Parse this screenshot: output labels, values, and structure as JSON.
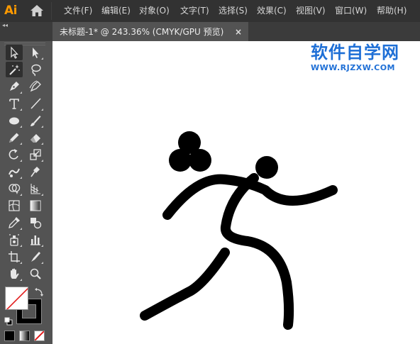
{
  "app": {
    "logo": "Ai"
  },
  "menu": {
    "items": [
      "文件(F)",
      "编辑(E)",
      "对象(O)",
      "文字(T)",
      "选择(S)",
      "效果(C)",
      "视图(V)",
      "窗口(W)",
      "帮助(H)"
    ]
  },
  "panel": {
    "collapse_glyph": "◂◂"
  },
  "document_tab": {
    "label": "未标题-1* @ 243.36% (CMYK/GPU 预览)",
    "close_glyph": "×"
  },
  "toolbar": {
    "tools": [
      "selection-tool",
      "direct-selection-tool",
      "magic-wand-tool",
      "lasso-tool",
      "pen-tool",
      "curvature-tool",
      "type-tool",
      "line-segment-tool",
      "ellipse-tool",
      "paintbrush-tool",
      "pencil-tool",
      "eraser-tool",
      "rotate-tool",
      "scale-tool",
      "puppet-warp-tool",
      "free-transform-tool",
      "shape-builder-tool",
      "perspective-grid-tool",
      "mesh-tool",
      "gradient-tool",
      "eyedropper-tool",
      "blend-tool",
      "symbol-sprayer-tool",
      "column-graph-tool",
      "artboard-tool",
      "slice-tool",
      "hand-tool",
      "zoom-tool"
    ],
    "active_tool": "selection-tool",
    "fill_color": "#ffffff",
    "stroke_color": "#000000",
    "fill_is_none": true
  },
  "watermark": {
    "title": "软件自学网",
    "url": "WWW.RJZXW.COM",
    "color": "#1e6fd6"
  },
  "colors": {
    "menubar": "#323232",
    "panel": "#535353",
    "canvas": "#ffffff",
    "artwork": "#000000",
    "logo": "#ff9a00"
  }
}
